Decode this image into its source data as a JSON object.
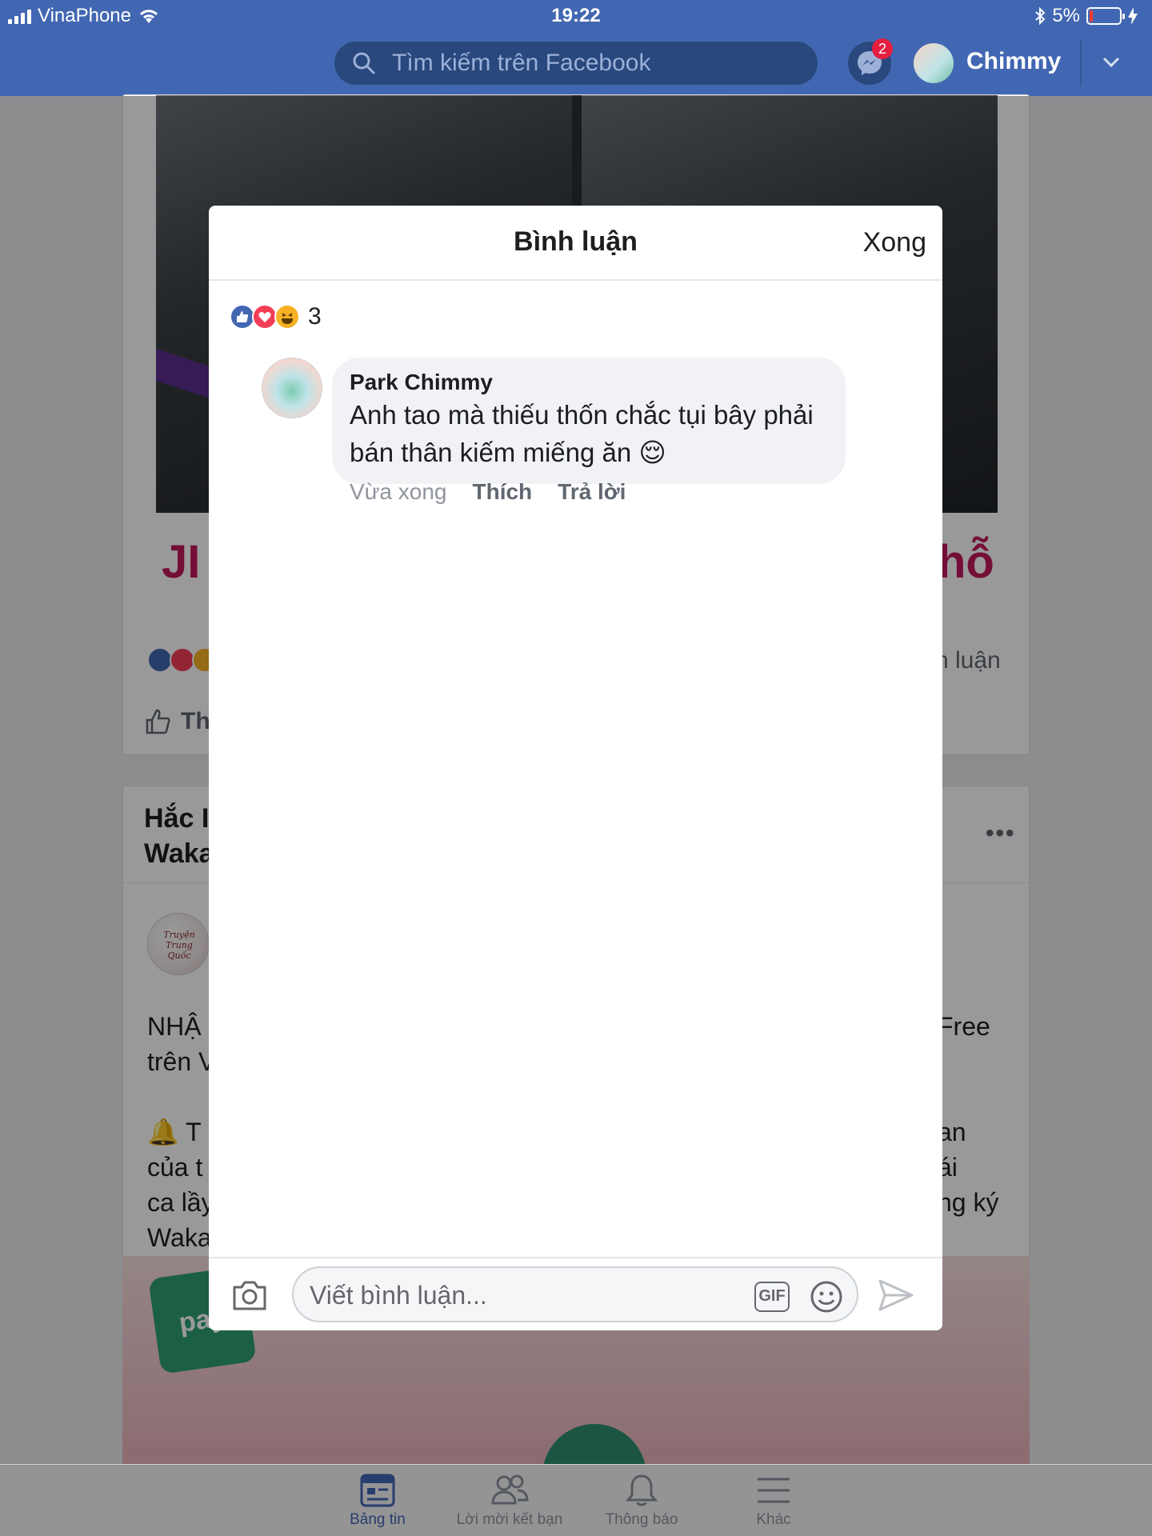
{
  "status_bar": {
    "carrier": "VinaPhone",
    "time": "19:22",
    "battery": "5%",
    "battery_level": 0.05
  },
  "header": {
    "search_placeholder": "Tìm kiếm trên Facebook",
    "messenger_badge": "2",
    "profile_name": "Chimmy",
    "colors": {
      "bar": "#4267b2",
      "search": "#29487d",
      "badge": "#e41e3f"
    }
  },
  "background_feed": {
    "video_title_left": "JI",
    "video_title_right": "hỗ",
    "comments_fragment": "h luận",
    "like_fragment": "Th",
    "post2_title_line1": "Hắc I",
    "post2_title_line2": "Waka",
    "post2_text_left": [
      "NHẬ",
      "trên V",
      "",
      "🔔 T",
      "của t",
      "ca lầy",
      "Waka"
    ],
    "post2_text_right": [
      "Free",
      "",
      "",
      "an",
      "ái",
      "ng ký"
    ],
    "page_avatar_text": "Truyện Trung Quốc",
    "ad_logo": "pay"
  },
  "modal": {
    "title": "Bình luận",
    "done_label": "Xong",
    "reactions": {
      "icons": [
        "like-icon",
        "love-icon",
        "haha-icon"
      ],
      "count": "3"
    },
    "comments": [
      {
        "author": "Park Chimmy",
        "text_line1": "Anh tao mà thiếu thốn chắc tụi bây phải",
        "text_line2": "bán thân kiếm miếng ăn 😌",
        "time": "Vừa xong",
        "like_label": "Thích",
        "reply_label": "Trả lời"
      }
    ],
    "composer": {
      "placeholder": "Viết bình luận...",
      "gif_label": "GIF"
    }
  },
  "tab_bar": {
    "tabs": [
      {
        "label": "Bảng tin",
        "icon": "news-feed-icon",
        "active": true
      },
      {
        "label": "Lời mời kết bạn",
        "icon": "friends-icon",
        "active": false
      },
      {
        "label": "Thông báo",
        "icon": "bell-icon",
        "active": false
      },
      {
        "label": "Khác",
        "icon": "menu-icon",
        "active": false
      }
    ],
    "active_color": "#4267b2"
  }
}
